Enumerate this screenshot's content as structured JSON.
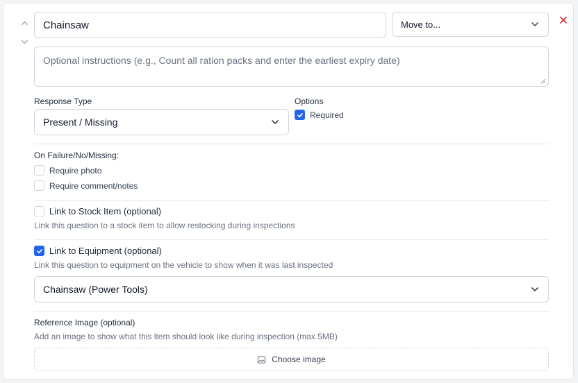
{
  "question": {
    "title_value": "Chainsaw",
    "instructions_placeholder": "Optional instructions (e.g., Count all ration packs and enter the earliest expiry date)"
  },
  "move_to": {
    "selected": "Move to..."
  },
  "response_type": {
    "label": "Response Type",
    "selected": "Present / Missing"
  },
  "options": {
    "label": "Options",
    "required_label": "Required",
    "required_checked": true
  },
  "on_failure": {
    "label": "On Failure/No/Missing:",
    "require_photo_label": "Require photo",
    "require_photo_checked": false,
    "require_comment_label": "Require comment/notes",
    "require_comment_checked": false
  },
  "stock_link": {
    "label": "Link to Stock Item (optional)",
    "checked": false,
    "help": "Link this question to a stock item to allow restocking during inspections"
  },
  "equipment_link": {
    "label": "Link to Equipment (optional)",
    "checked": true,
    "help": "Link this question to equipment on the vehicle to show when it was last inspected",
    "selected": "Chainsaw (Power Tools)"
  },
  "reference_image": {
    "label": "Reference Image (optional)",
    "help": "Add an image to show what this item should look like during inspection (max 5MB)",
    "button_label": "Choose image"
  },
  "icons": {
    "up": "chevron-up-icon",
    "down": "chevron-down-icon",
    "remove": "close-icon",
    "check": "checkmark-icon",
    "image": "image-icon"
  },
  "colors": {
    "accent": "#2563eb",
    "danger": "#dc2626",
    "border": "#d1d5db",
    "muted_text": "#6b7280"
  }
}
